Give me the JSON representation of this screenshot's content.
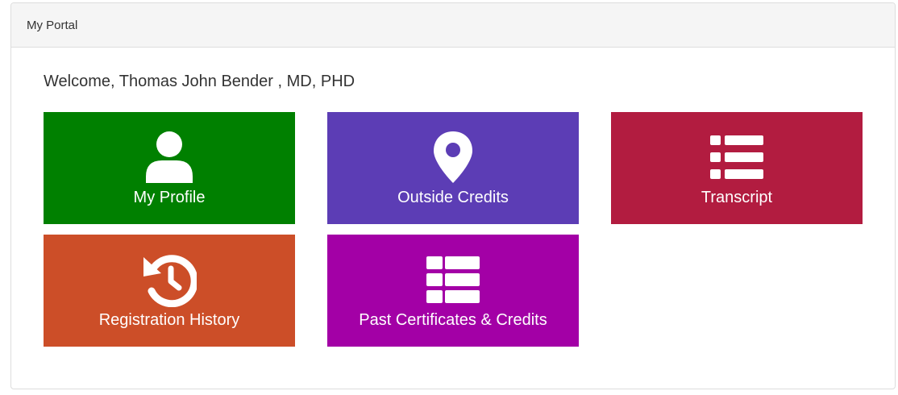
{
  "panel": {
    "title": "My Portal"
  },
  "welcome": {
    "text": "Welcome, Thomas John Bender , MD, PHD"
  },
  "tiles": [
    {
      "label": "My Profile",
      "icon": "user-icon",
      "color": "#008000"
    },
    {
      "label": "Outside Credits",
      "icon": "map-marker-icon",
      "color": "#5c3db5"
    },
    {
      "label": "Transcript",
      "icon": "list-icon",
      "color": "#b21c40"
    },
    {
      "label": "Registration History",
      "icon": "history-icon",
      "color": "#cc4e28"
    },
    {
      "label": "Past Certificates & Credits",
      "icon": "table-list-icon",
      "color": "#a300a6"
    }
  ]
}
